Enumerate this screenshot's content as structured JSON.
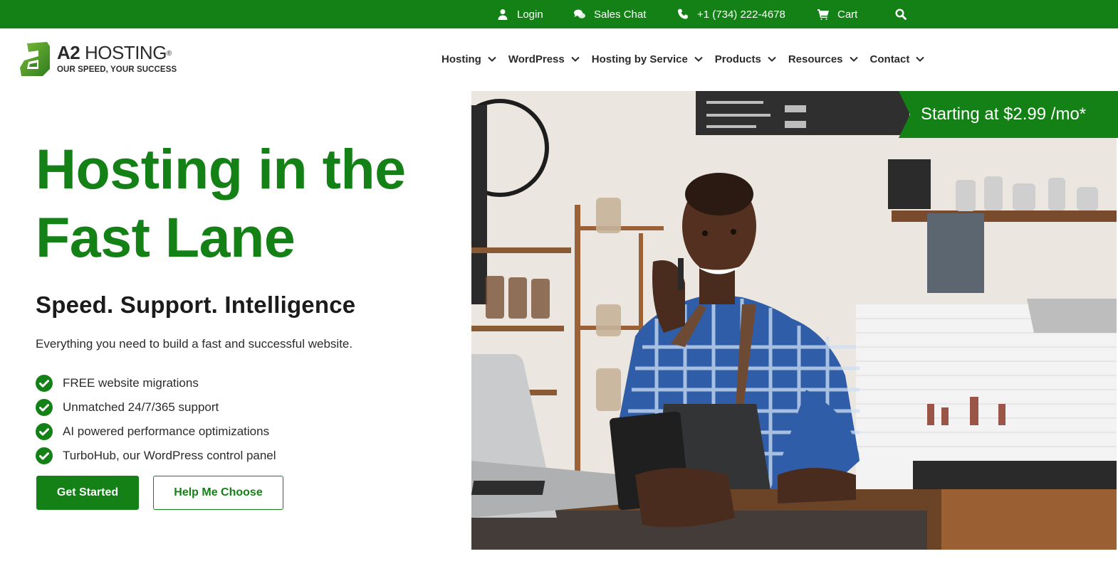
{
  "colors": {
    "brand_green": "#138115",
    "text_dark": "#1b1b1b",
    "white": "#ffffff"
  },
  "topbar": {
    "items": [
      {
        "icon": "user-icon",
        "label": "Login"
      },
      {
        "icon": "chat-icon",
        "label": "Sales Chat"
      },
      {
        "icon": "phone-icon",
        "label": "+1 (734) 222-4678"
      },
      {
        "icon": "cart-icon",
        "label": "Cart"
      },
      {
        "icon": "search-icon",
        "label": ""
      }
    ]
  },
  "logo": {
    "name_bold": "A2",
    "name_rest": " HOSTING",
    "registered": "®",
    "tagline": "OUR SPEED, YOUR SUCCESS"
  },
  "nav": {
    "items": [
      {
        "label": "Hosting"
      },
      {
        "label": "WordPress"
      },
      {
        "label": "Hosting by Service"
      },
      {
        "label": "Products"
      },
      {
        "label": "Resources"
      },
      {
        "label": "Contact"
      }
    ]
  },
  "hero": {
    "title_line1": "Hosting in the",
    "title_line2": "Fast Lane",
    "subtitle": "Speed. Support. Intelligence",
    "description": "Everything you need to build a fast and successful website.",
    "features": [
      "FREE website migrations",
      "Unmatched 24/7/365 support",
      "AI powered performance optimizations",
      "TurboHub, our WordPress control panel"
    ],
    "primary_button": "Get Started",
    "secondary_button": "Help Me Choose",
    "price_badge": "Starting at $2.99 /mo*",
    "image_alt": "Smiling barista in blue plaid shirt and apron talking on phone at cafe counter"
  }
}
